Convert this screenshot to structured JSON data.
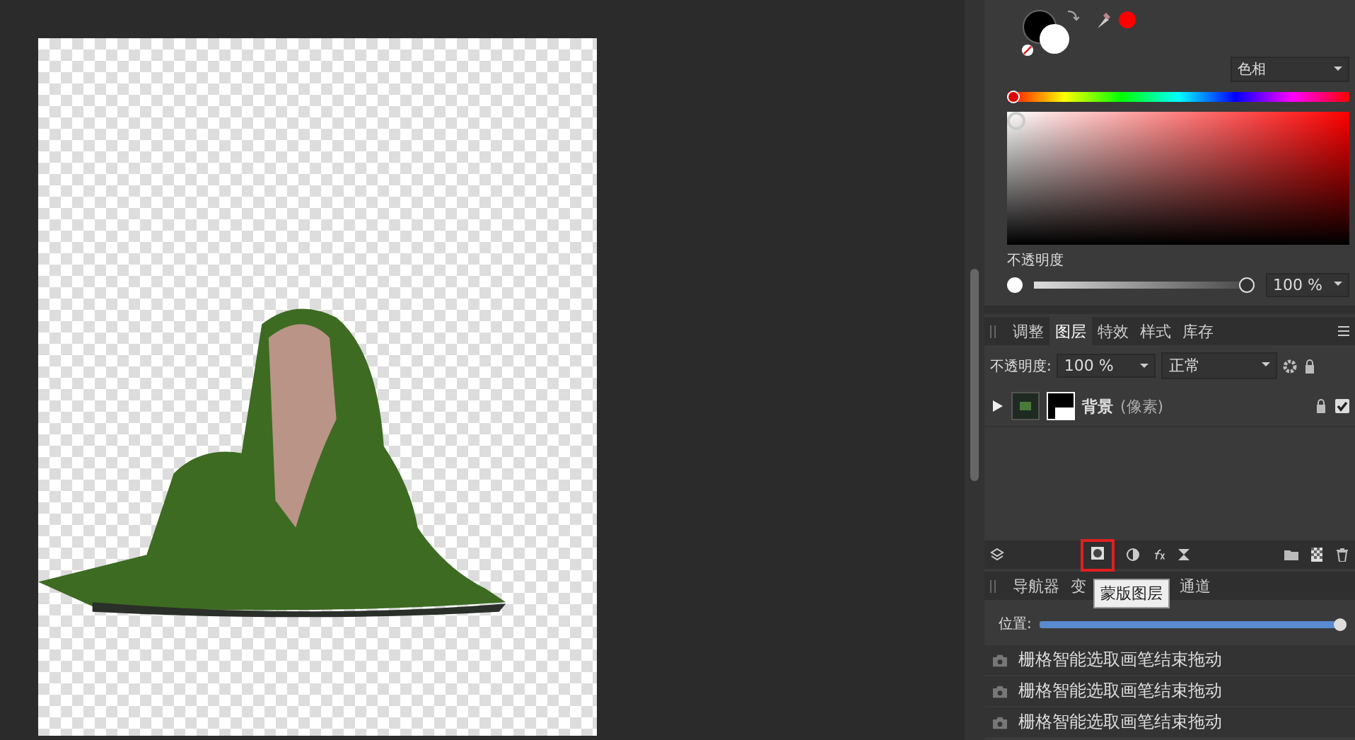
{
  "color_panel": {
    "mode": "色相",
    "hue": {
      "level": 0
    },
    "opacity_label": "不透明度",
    "opacity": {
      "level": 1,
      "reading": "100 %"
    }
  },
  "layers_panel": {
    "tabs": [
      {
        "label": "调整",
        "selected": false
      },
      {
        "label": "图层",
        "selected": true
      },
      {
        "label": "特效",
        "selected": false
      },
      {
        "label": "样式",
        "selected": false
      },
      {
        "label": "库存",
        "selected": false
      }
    ],
    "opacity_label": "不透明度:",
    "opacity_value": "100 %",
    "blend_mode": "正常",
    "layers": [
      {
        "name": "背景",
        "type": "(像素)",
        "expanded": false,
        "locked": true,
        "visible": true
      }
    ],
    "tooltip": "蒙版图层"
  },
  "history_panel": {
    "tabs": [
      {
        "label": "导航器",
        "selected": false
      },
      {
        "label": "变",
        "selected": false
      },
      {
        "label": "通道",
        "selected": false
      }
    ],
    "position_label": "位置:",
    "position": {
      "level": 1
    },
    "items": [
      "栅格智能选取画笔结束拖动",
      "栅格智能选取画笔结束拖动",
      "栅格智能选取画笔结束拖动"
    ]
  }
}
